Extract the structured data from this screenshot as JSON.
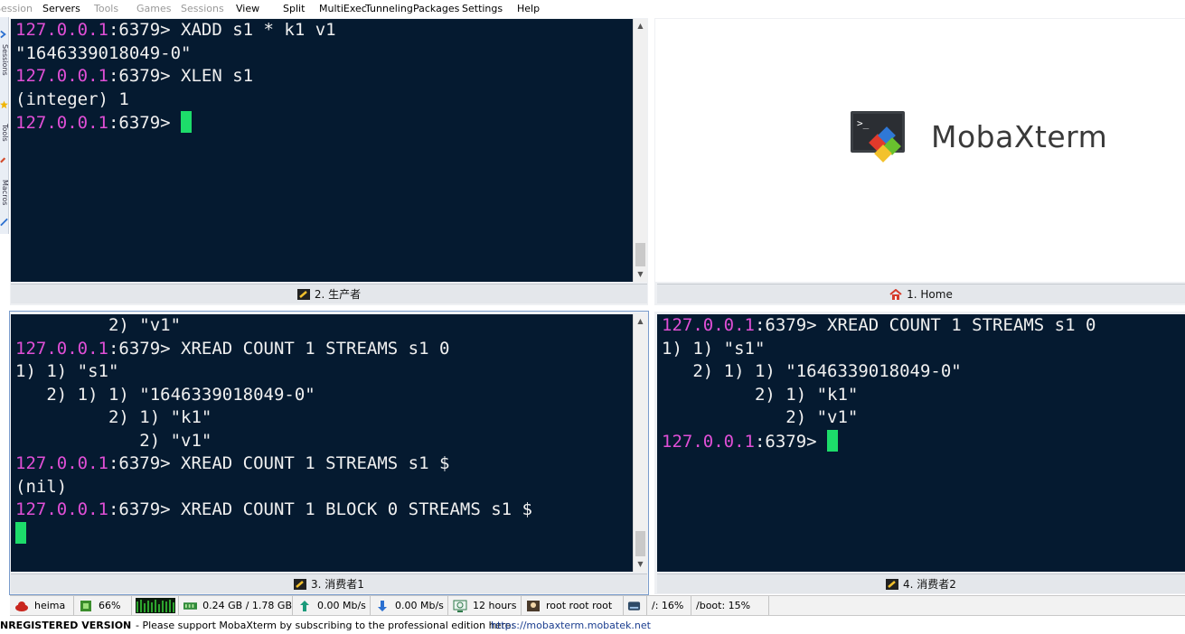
{
  "menu": {
    "items": [
      {
        "label": "Session",
        "dim": true
      },
      {
        "label": "Servers",
        "dim": false
      },
      {
        "label": "Tools",
        "dim": true
      },
      {
        "label": "Games",
        "dim": true
      },
      {
        "label": "Sessions",
        "dim": true
      },
      {
        "label": "View",
        "dim": false
      },
      {
        "label": "Split",
        "dim": false
      },
      {
        "label": "MultiExec",
        "dim": false
      },
      {
        "label": "Tunneling",
        "dim": false
      },
      {
        "label": "Packages",
        "dim": false
      },
      {
        "label": "Settings",
        "dim": false
      },
      {
        "label": "Help",
        "dim": false
      }
    ]
  },
  "sidebar": {
    "tabs": [
      "Sessions",
      "Tools",
      "Macros"
    ]
  },
  "panes": {
    "producer": {
      "tab_label": "2. 生产者",
      "lines": [
        {
          "ip": "127.0.0.1",
          "rest": ":6379> XADD s1 * k1 v1"
        },
        {
          "text": "\"1646339018049-0\""
        },
        {
          "ip": "127.0.0.1",
          "rest": ":6379> XLEN s1"
        },
        {
          "text": "(integer) 1"
        },
        {
          "ip": "127.0.0.1",
          "rest": ":6379> ",
          "cursor": true
        }
      ]
    },
    "home": {
      "tab_label": "1. Home",
      "logo_text": "MobaXterm",
      "logo_glyph": ">_"
    },
    "consumer1": {
      "tab_label": "3. 消费者1",
      "lines": [
        {
          "text": "         2) \"v1\""
        },
        {
          "ip": "127.0.0.1",
          "rest": ":6379> XREAD COUNT 1 STREAMS s1 0"
        },
        {
          "text": "1) 1) \"s1\""
        },
        {
          "text": "   2) 1) 1) \"1646339018049-0\""
        },
        {
          "text": "         2) 1) \"k1\""
        },
        {
          "text": "            2) \"v1\""
        },
        {
          "ip": "127.0.0.1",
          "rest": ":6379> XREAD COUNT 1 STREAMS s1 $"
        },
        {
          "text": "(nil)"
        },
        {
          "ip": "127.0.0.1",
          "rest": ":6379> XREAD COUNT 1 BLOCK 0 STREAMS s1 $"
        },
        {
          "cursor": true
        }
      ]
    },
    "consumer2": {
      "tab_label": "4. 消费者2",
      "lines": [
        {
          "ip": "127.0.0.1",
          "rest": ":6379> XREAD COUNT 1 STREAMS s1 0"
        },
        {
          "text": "1) 1) \"s1\""
        },
        {
          "text": "   2) 1) 1) \"1646339018049-0\""
        },
        {
          "text": "         2) 1) \"k1\""
        },
        {
          "text": "            2) \"v1\""
        },
        {
          "ip": "127.0.0.1",
          "rest": ":6379> ",
          "cursor": true
        }
      ]
    }
  },
  "status": {
    "user": "heima",
    "cpu": "66%",
    "memory": "0.24 GB / 1.78 GB",
    "upload": "0.00 Mb/s",
    "download": "0.00 Mb/s",
    "uptime": "12 hours",
    "users": "root  root  root",
    "disk_root": "/: 16%",
    "disk_boot": "/boot: 15%"
  },
  "footer": {
    "version": "NREGISTERED VERSION",
    "message": "-  Please support MobaXterm by subscribing to the professional edition here:",
    "link": "https://mobaxterm.mobatek.net"
  },
  "colors": {
    "terminal_bg": "#051a30",
    "prompt_ip": "#e04fd6",
    "cursor": "#1ddc6a"
  }
}
